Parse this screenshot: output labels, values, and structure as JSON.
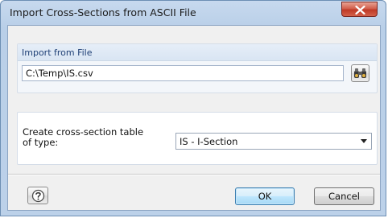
{
  "window": {
    "title": "Import Cross-Sections from ASCII File",
    "close_icon": "close-x-icon"
  },
  "import_group": {
    "title": "Import from File",
    "file_path": "C:\\Temp\\IS.csv",
    "browse_icon": "binoculars-icon"
  },
  "create_group": {
    "label_line1": "Create cross-section table",
    "label_line2": "of type:",
    "selected_type": "IS - I-Section"
  },
  "footer": {
    "help_icon": "help-icon",
    "ok_label": "OK",
    "cancel_label": "Cancel"
  },
  "colors": {
    "title_bar": "#bcd1e9",
    "close_button": "#c94a35",
    "group_title_text": "#1e3f75",
    "ok_button": "#bee6fd"
  }
}
